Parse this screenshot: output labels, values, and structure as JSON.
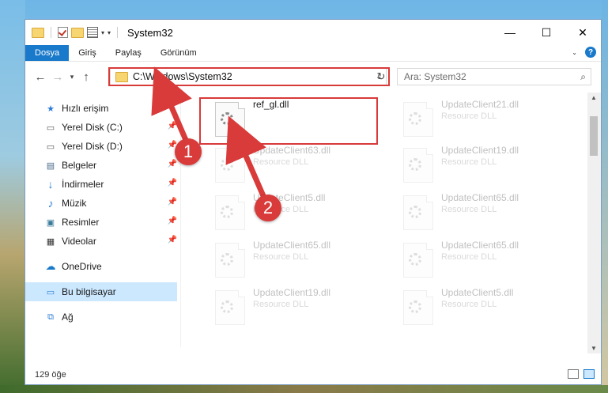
{
  "window": {
    "title": "System32",
    "controls": {
      "minimize": "—",
      "maximize": "☐",
      "close": "✕"
    }
  },
  "ribbon": {
    "tabs": [
      "Dosya",
      "Giriş",
      "Paylaş",
      "Görünüm"
    ],
    "help": "?"
  },
  "navigation": {
    "address": "C:\\Windows\\System32",
    "search_placeholder": "Ara: System32"
  },
  "sidebar": {
    "items": [
      {
        "label": "Hızlı erişim",
        "icon": "star-icon",
        "pinned": false
      },
      {
        "label": "Yerel Disk (C:)",
        "icon": "drive-icon",
        "pinned": true
      },
      {
        "label": "Yerel Disk (D:)",
        "icon": "drive-icon",
        "pinned": true
      },
      {
        "label": "Belgeler",
        "icon": "document-icon",
        "pinned": true
      },
      {
        "label": "İndirmeler",
        "icon": "download-icon",
        "pinned": true
      },
      {
        "label": "Müzik",
        "icon": "music-icon",
        "pinned": true
      },
      {
        "label": "Resimler",
        "icon": "picture-icon",
        "pinned": true
      },
      {
        "label": "Videolar",
        "icon": "video-icon",
        "pinned": true
      },
      {
        "label": "OneDrive",
        "icon": "cloud-icon",
        "pinned": false
      },
      {
        "label": "Bu bilgisayar",
        "icon": "computer-icon",
        "pinned": false
      },
      {
        "label": "Ağ",
        "icon": "network-icon",
        "pinned": false
      }
    ]
  },
  "files": [
    {
      "name": "ref_gl.dll",
      "type": ""
    },
    {
      "name": "UpdateClient21.dll",
      "type": "Resource DLL"
    },
    {
      "name": "UpdateClient63.dll",
      "type": "Resource DLL"
    },
    {
      "name": "UpdateClient19.dll",
      "type": "Resource DLL"
    },
    {
      "name": "UpdateClient5.dll",
      "type": "Resource DLL"
    },
    {
      "name": "UpdateClient65.dll",
      "type": "Resource DLL"
    },
    {
      "name": "UpdateClient65.dll",
      "type": "Resource DLL"
    },
    {
      "name": "UpdateClient65.dll",
      "type": "Resource DLL"
    },
    {
      "name": "UpdateClient19.dll",
      "type": "Resource DLL"
    },
    {
      "name": "UpdateClient5.dll",
      "type": "Resource DLL"
    }
  ],
  "status": {
    "count": "129 öğe"
  },
  "markers": {
    "one": "1",
    "two": "2"
  },
  "colors": {
    "accent": "#1979ca",
    "highlight": "#d93a3a",
    "selected": "#cce8ff"
  }
}
